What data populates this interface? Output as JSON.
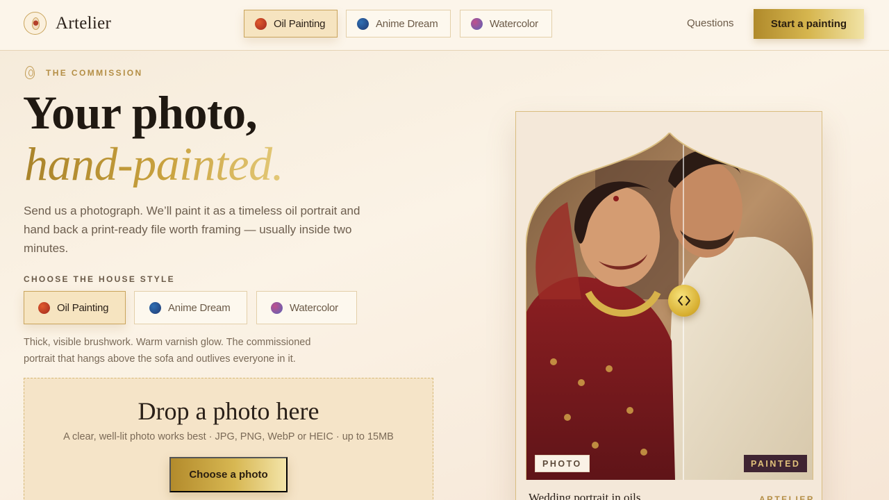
{
  "brand": {
    "name": "Artelier"
  },
  "nav": {
    "styles": [
      {
        "label": "Oil Painting",
        "dot": "oil",
        "active": true
      },
      {
        "label": "Anime Dream",
        "dot": "anime",
        "active": false
      },
      {
        "label": "Watercolor",
        "dot": "water",
        "active": false
      }
    ],
    "questions": "Questions",
    "cta": "Start a painting"
  },
  "hero": {
    "eyebrow": "THE COMMISSION",
    "title_line1": "Your photo,",
    "title_line2": "hand-painted.",
    "lead": "Send us a photograph. We’ll paint it as a timeless oil portrait and hand back a print-ready file worth framing — usually inside two minutes."
  },
  "house_style": {
    "label": "CHOOSE THE HOUSE STYLE",
    "options": [
      {
        "label": "Oil Painting",
        "dot": "oil",
        "active": true
      },
      {
        "label": "Anime Dream",
        "dot": "anime",
        "active": false
      },
      {
        "label": "Watercolor",
        "dot": "water",
        "active": false
      }
    ],
    "description": "Thick, visible brushwork. Warm varnish glow. The commissioned portrait that hangs above the sofa and outlives everyone in it."
  },
  "upload": {
    "title": "Drop a photo here",
    "subtitle": "A clear, well-lit photo works best · JPG, PNG, WebP or HEIC · up to 15MB",
    "button": "Choose a photo"
  },
  "preview": {
    "tag_before": "PHOTO",
    "tag_after": "PAINTED",
    "caption": "Wedding portrait in oils",
    "brand": "ARTELIER"
  },
  "colors": {
    "gold": "#c9a45c",
    "cta_gold": "#d6b64f",
    "painted_tag": "#3f2432",
    "background": "#fbf3e6"
  },
  "icons": {
    "logo": "drop-seal-icon",
    "eyebrow": "drop-icon",
    "compare": "chevrons-left-right-icon"
  }
}
